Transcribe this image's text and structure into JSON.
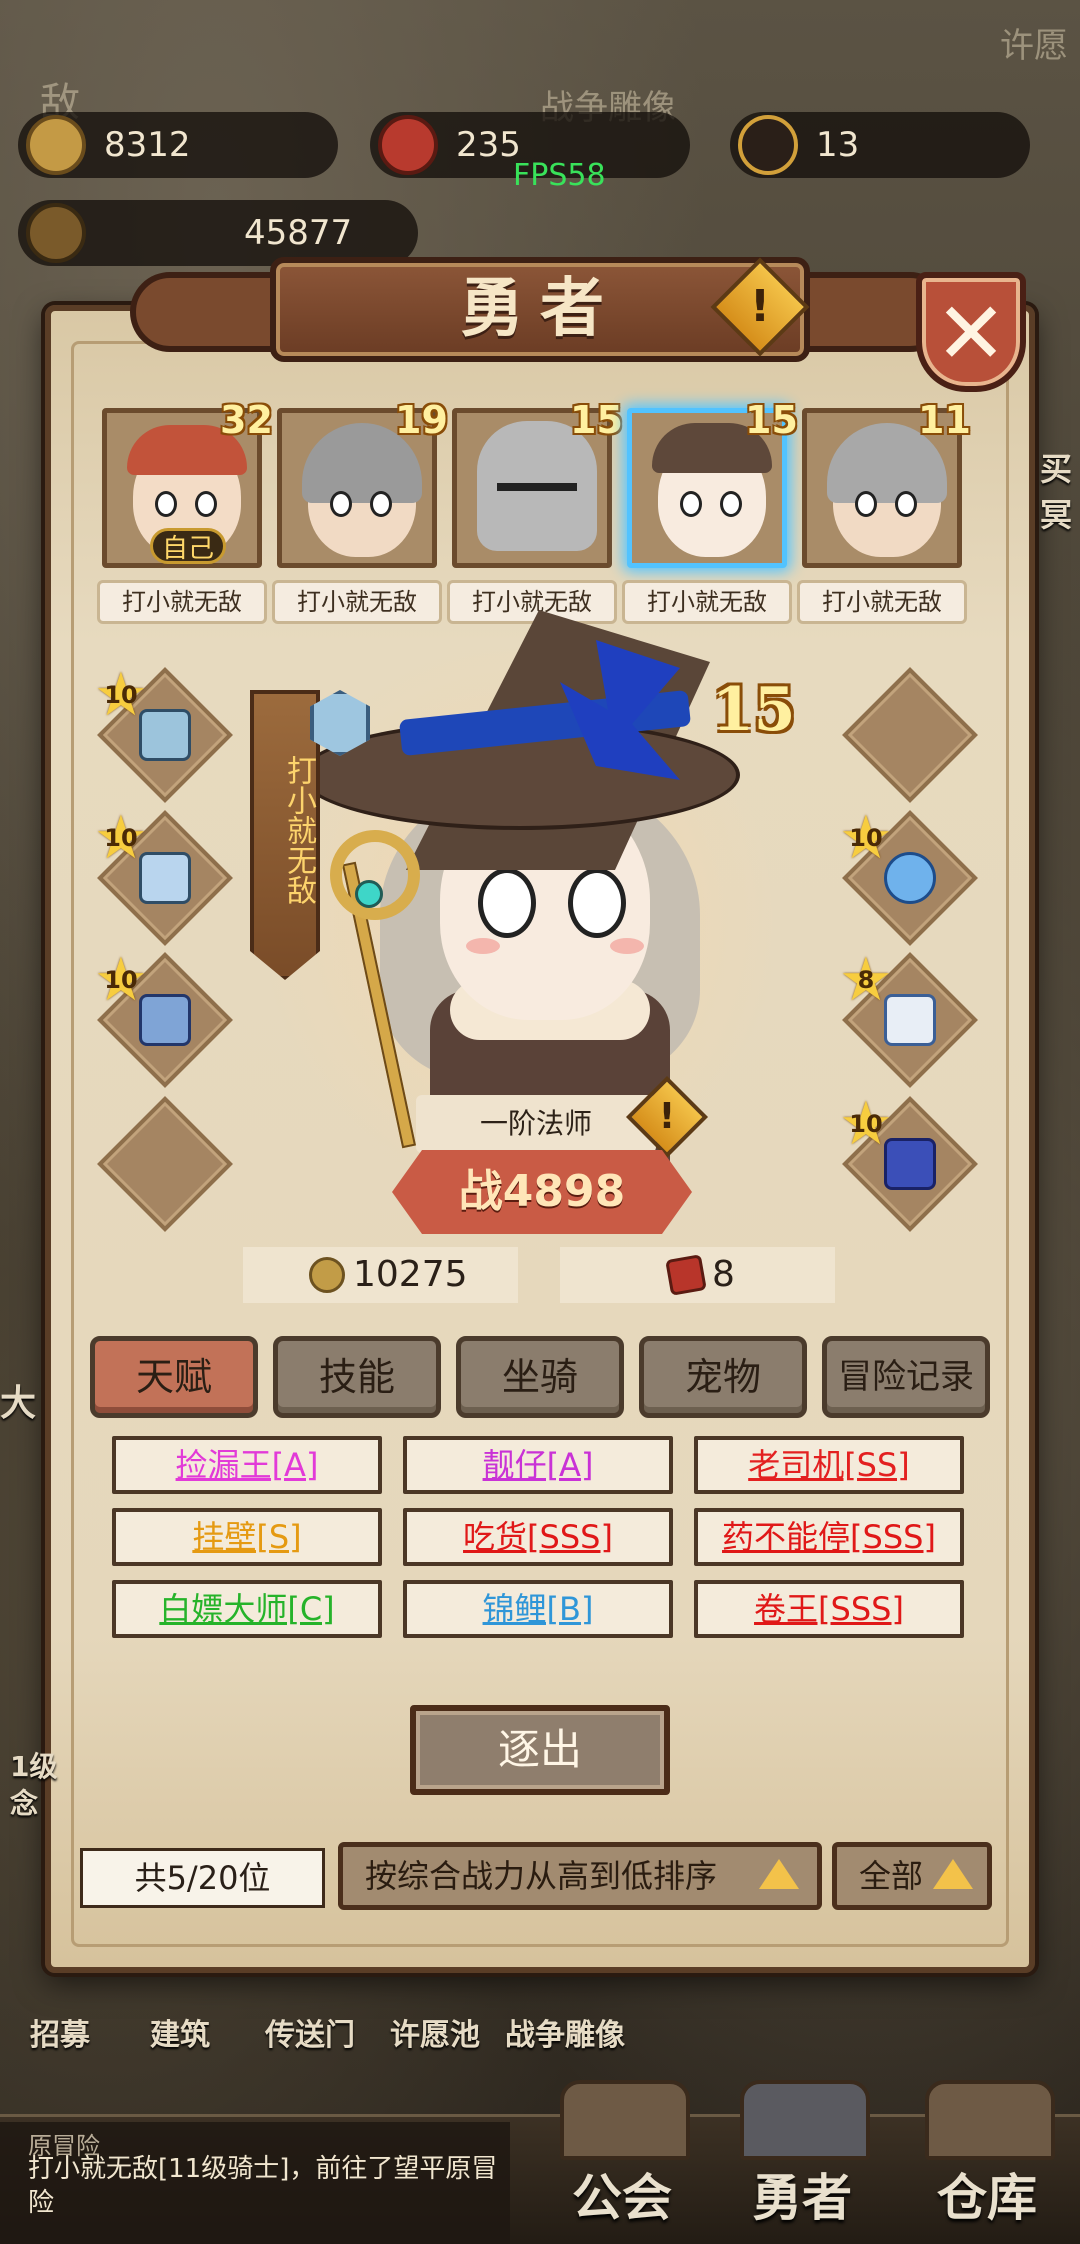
{
  "top": {
    "coins": "8312",
    "medals": "235",
    "souls": "13",
    "power": "45877",
    "fps": "FPS58",
    "bg_statue": "战争雕像",
    "bg_wish": "许愿",
    "bg_partial_left": "敌"
  },
  "panel": {
    "title": "勇者",
    "close_label": "✕",
    "warn_label": "!"
  },
  "heroes": [
    {
      "level": "32",
      "name": "打小就无敌",
      "badge": "自己"
    },
    {
      "level": "19",
      "name": "打小就无敌"
    },
    {
      "level": "15",
      "name": "打小就无敌"
    },
    {
      "level": "15",
      "name": "打小就无敌",
      "selected": true
    },
    {
      "level": "11",
      "name": "打小就无敌"
    }
  ],
  "equipment": {
    "left": [
      {
        "stars": "10",
        "icon": "staff-icon"
      },
      {
        "stars": "10",
        "icon": "cloak-icon"
      },
      {
        "stars": "10",
        "icon": "helmet-icon"
      },
      {
        "stars": "",
        "icon": "empty-slot"
      }
    ],
    "right": [
      {
        "stars": "",
        "icon": "empty-slot"
      },
      {
        "stars": "10",
        "icon": "orb-icon"
      },
      {
        "stars": "8",
        "icon": "robe-icon"
      },
      {
        "stars": "10",
        "icon": "belt-icon"
      }
    ]
  },
  "selected_hero": {
    "owner": "打小就无敌",
    "level": "15",
    "class": "一阶法师",
    "power_label": "战",
    "power": "4898",
    "gold": "10275",
    "tickets": "8"
  },
  "tabs": [
    "天赋",
    "技能",
    "坐骑",
    "宠物",
    "冒险记录"
  ],
  "talents": [
    {
      "label": "捡漏王[A]",
      "color": "#e23ad8"
    },
    {
      "label": "靓仔[A]",
      "color": "#c932d6"
    },
    {
      "label": "老司机[SS]",
      "color": "#e32020"
    },
    {
      "label": "挂壁[S]",
      "color": "#e59a12"
    },
    {
      "label": "吃货[SSS]",
      "color": "#e01818"
    },
    {
      "label": "药不能停[SSS]",
      "color": "#e01818"
    },
    {
      "label": "白嫖大师[C]",
      "color": "#26b32a"
    },
    {
      "label": "锦鲤[B]",
      "color": "#2f96d8"
    },
    {
      "label": "卷王[SSS]",
      "color": "#e01818"
    }
  ],
  "actions": {
    "expel": "逐出",
    "count": "共5/20位",
    "sort": "按综合战力从高到低排序",
    "filter": "全部"
  },
  "bottom": {
    "shortcuts": [
      "招募",
      "建筑",
      "传送门",
      "许愿池",
      "战争雕像"
    ],
    "news_head": "原冒险",
    "news_body": "打小就无敌[11级骑士]，前往了望平原冒险",
    "nav": [
      "公会",
      "勇者",
      "仓库"
    ],
    "side_left_a": "大",
    "side_left_b": "1级",
    "side_left_c": "念",
    "side_right": "买冥"
  },
  "colors": {
    "accent": "#c27258",
    "selected_glow": "#58c6ff",
    "panel": "#e5d7bb"
  }
}
